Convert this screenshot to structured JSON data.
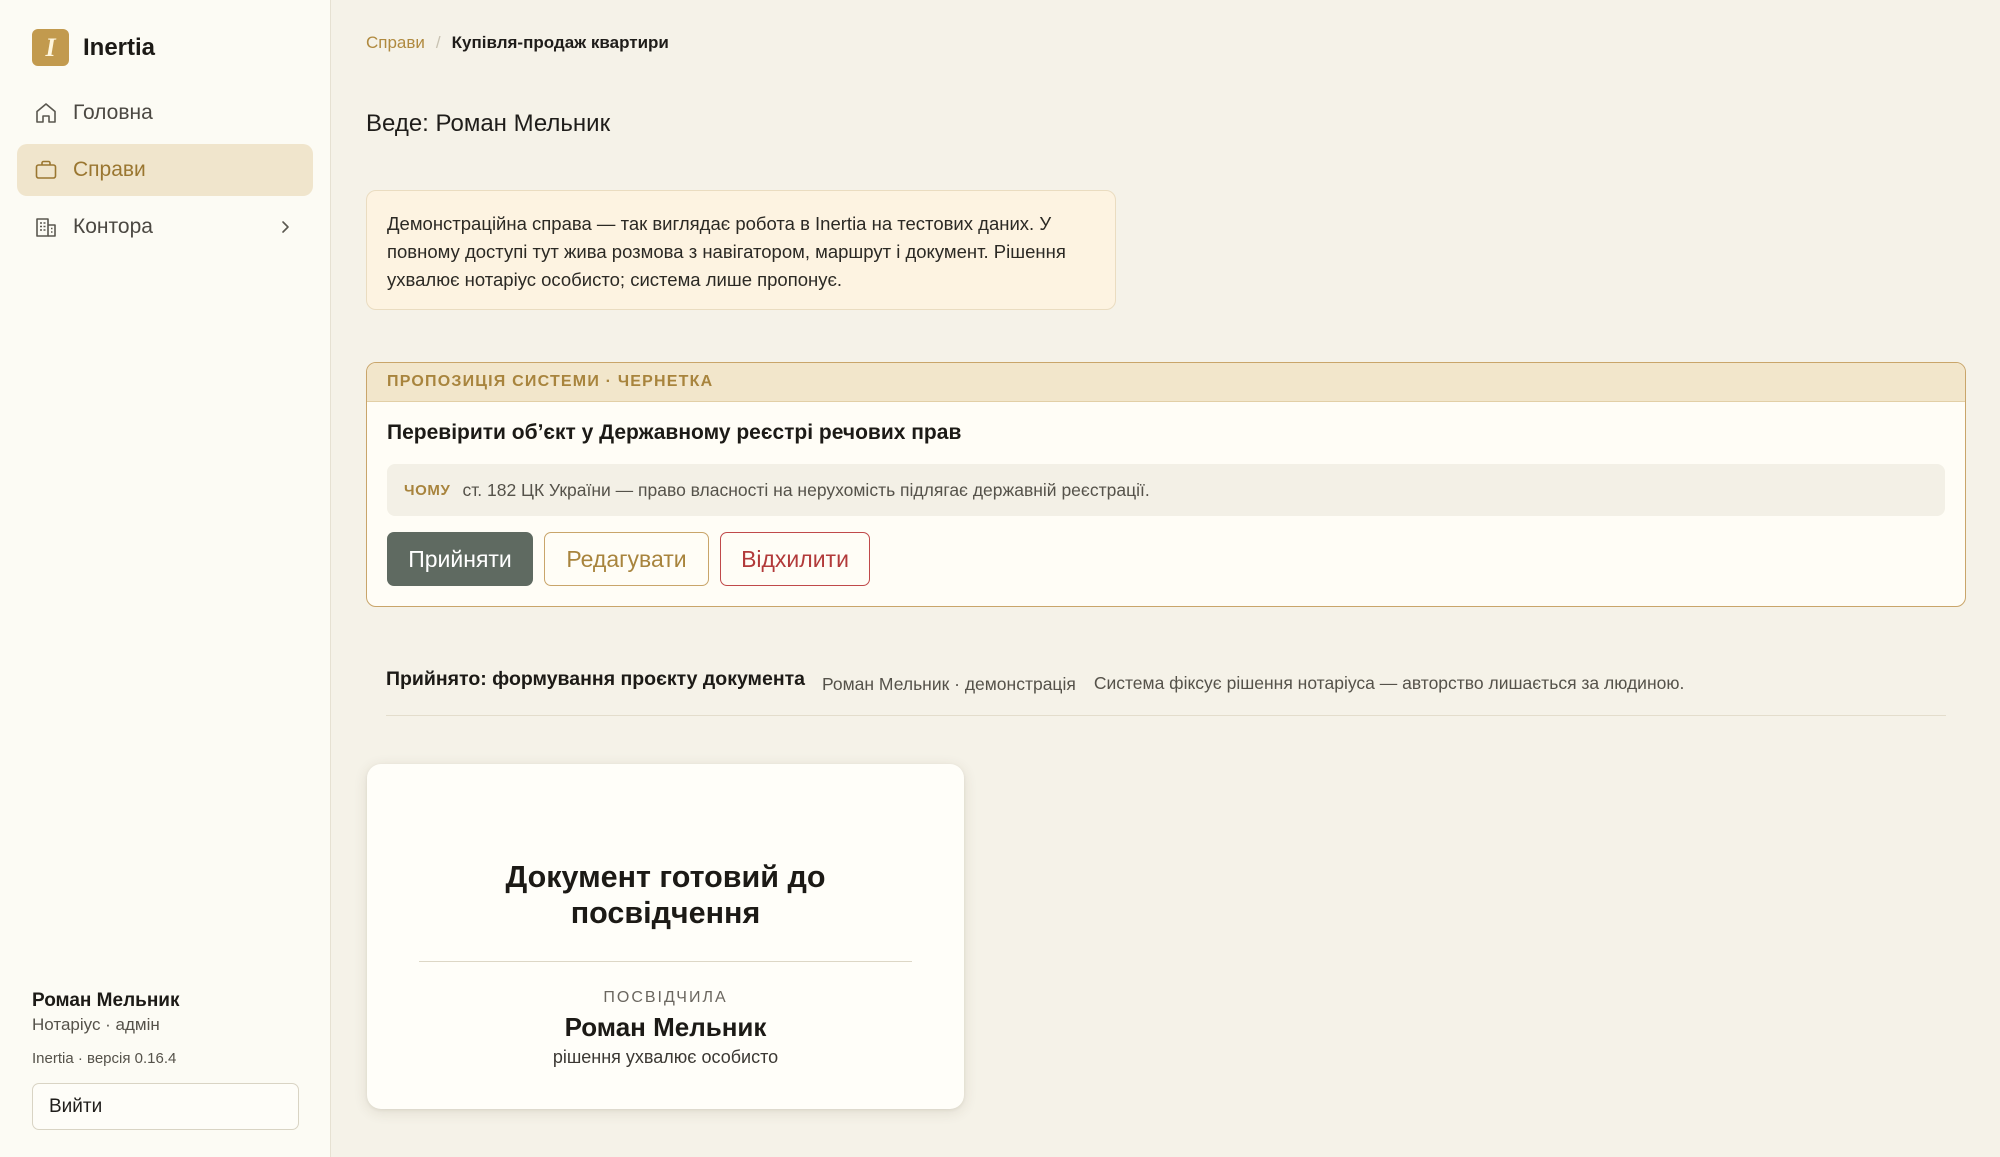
{
  "app": {
    "name": "Inertia",
    "logo_letter": "I"
  },
  "sidebar": {
    "items": [
      {
        "label": "Головна",
        "icon": "home-icon"
      },
      {
        "label": "Справи",
        "icon": "briefcase-icon",
        "active": true
      },
      {
        "label": "Контора",
        "icon": "building-icon",
        "has_submenu": true
      }
    ],
    "user": {
      "name": "Роман Мельник",
      "role": "Нотаріус · адмін"
    },
    "version": "Inertia · версія 0.16.4",
    "logout_label": "Вийти"
  },
  "breadcrumb": {
    "parent": "Справи",
    "separator": "/",
    "current": "Купівля-продаж квартири"
  },
  "lead": "Веде: Роман Мельник",
  "demo_note": "Демонстраційна справа — так виглядає робота в Inertia на тестових даних. У повному доступі тут жива розмова з навігатором, маршрут і документ. Рішення ухвалює нотаріус особисто; система лише пропонує.",
  "proposal": {
    "header": "ПРОПОЗИЦІЯ СИСТЕМИ · ЧЕРНЕТКА",
    "title": "Перевірити обʼєкт у Державному реєстрі речових прав",
    "why_label": "ЧОМУ",
    "why_text": "ст. 182 ЦК України — право власності на нерухомість підлягає державній реєстрації.",
    "accept_label": "Прийняти",
    "edit_label": "Редагувати",
    "reject_label": "Відхилити"
  },
  "accepted": {
    "title": "Прийнято: формування проєкту документа",
    "meta": "Роман Мельник · демонстрація",
    "note": "Система фіксує рішення нотаріуса — авторство лишається за людиною."
  },
  "document": {
    "title_line1": "Документ готовий до",
    "title_line2": "посвідчення",
    "cert_label": "ПОСВІДЧИЛА",
    "cert_name": "Роман Мельник",
    "cert_note": "рішення ухвалює особисто"
  },
  "colors": {
    "accent": "#b08a3f",
    "accept_button": "#5f6a61",
    "reject": "#b23a3a",
    "background": "#f5f2e8",
    "sidebar_active": "#f0e5cc"
  }
}
